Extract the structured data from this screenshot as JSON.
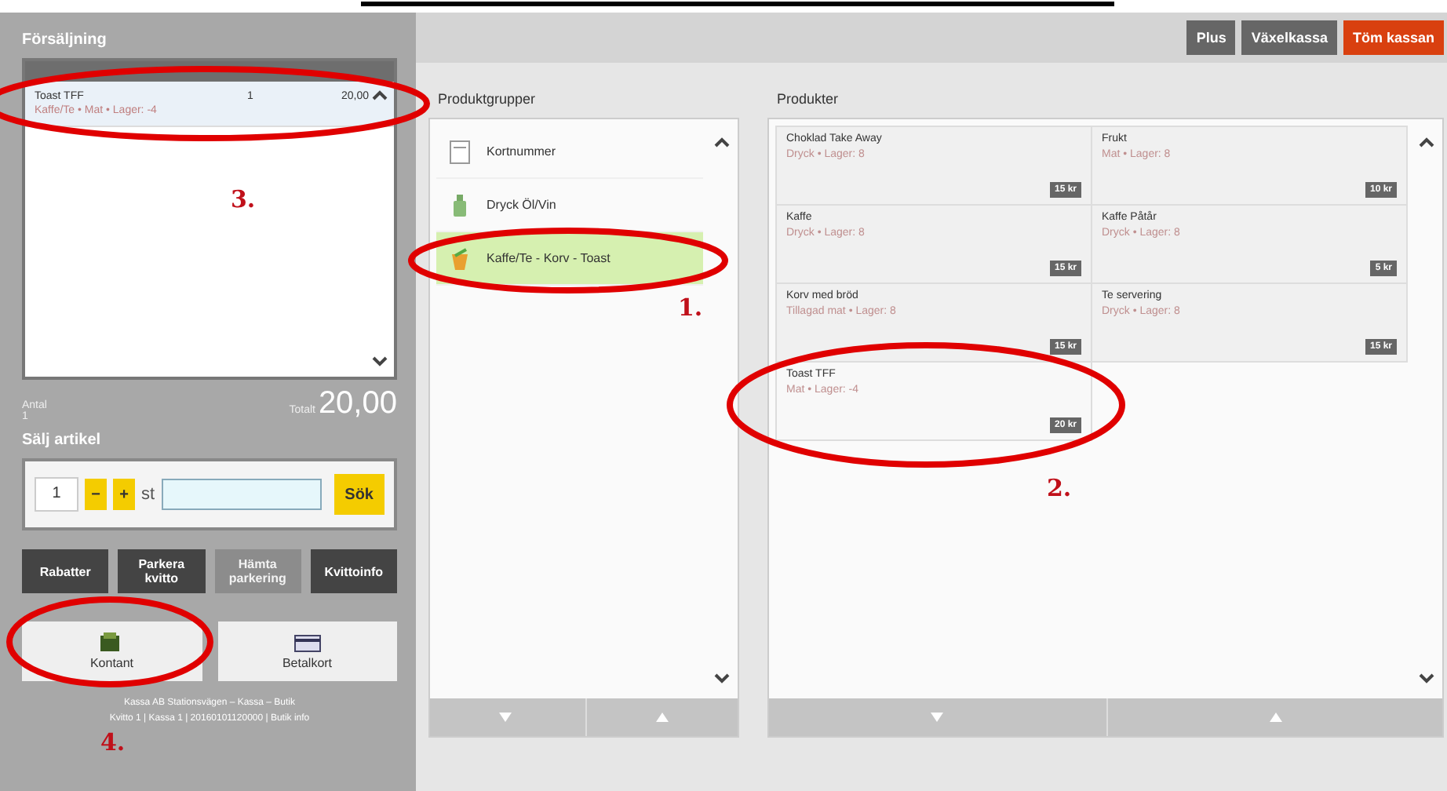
{
  "sale": {
    "title": "Försäljning",
    "order_rows": [
      {
        "name": "Toast TFF",
        "detail": "Kaffe/Te • Mat • Lager: -4",
        "qty": "1",
        "price": "20,00",
        "selected": true
      }
    ],
    "count_label": "Antal",
    "count": "1",
    "total_label": "Totalt",
    "total": "20,00"
  },
  "sell": {
    "title": "Sälj artikel",
    "qty": "1",
    "minus": "−",
    "plus": "+",
    "unit": "st",
    "search_button": "Sök"
  },
  "actions": [
    {
      "label": "Rabatter",
      "disabled": false
    },
    {
      "label": "Parkera kvitto",
      "disabled": false
    },
    {
      "label": "Hämta parkering",
      "disabled": true
    },
    {
      "label": "Kvittoinfo",
      "disabled": false
    }
  ],
  "payments": [
    {
      "label": "Kontant",
      "kind": "cash"
    },
    {
      "label": "Betalkort",
      "kind": "card"
    }
  ],
  "footer": [
    "Kassa AB Stationsvägen – Kassa – Butik",
    "Kvitto 1 | Kassa 1 | 20160101120000 | Butik info"
  ],
  "topbar": [
    {
      "label": "Plus",
      "kind": "plain"
    },
    {
      "label": "Växelkassa",
      "kind": "plain"
    },
    {
      "label": "Töm kassan",
      "kind": "danger"
    }
  ],
  "groups": {
    "title": "Produktgrupper",
    "items": [
      {
        "label": "Kortnummer",
        "kind": "card",
        "selected": false
      },
      {
        "label": "Dryck Öl/Vin",
        "kind": "bottle",
        "selected": false
      },
      {
        "label": "Kaffe/Te - Korv - Toast",
        "kind": "cup",
        "selected": true
      }
    ]
  },
  "products": {
    "title": "Produkter",
    "items": [
      {
        "name": "Choklad Take Away",
        "detail": "Dryck • Lager: 8",
        "price": "15 kr"
      },
      {
        "name": "Frukt",
        "detail": "Mat • Lager: 8",
        "price": "10 kr"
      },
      {
        "name": "Kaffe",
        "detail": "Dryck • Lager: 8",
        "price": "15 kr"
      },
      {
        "name": "Kaffe Påtår",
        "detail": "Dryck • Lager: 8",
        "price": "5 kr"
      },
      {
        "name": "Korv med bröd",
        "detail": "Tillagad mat • Lager: 8",
        "price": "15 kr"
      },
      {
        "name": "Te servering",
        "detail": "Dryck • Lager: 8",
        "price": "15 kr"
      },
      {
        "name": "Toast TFF",
        "detail": "Mat • Lager: -4",
        "price": "20 kr"
      }
    ]
  },
  "annotations": [
    {
      "label": "1."
    },
    {
      "label": "2."
    },
    {
      "label": "3."
    },
    {
      "label": "4."
    }
  ]
}
